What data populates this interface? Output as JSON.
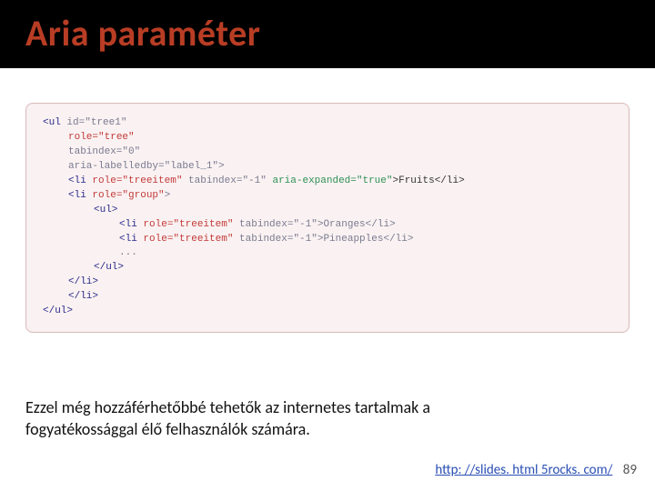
{
  "title": "Aria paraméter",
  "code": {
    "l1_open": "<ul",
    "l1_attr": " id=\"tree1\"",
    "l2_role_key": "role=",
    "l2_role_val": "\"tree\"",
    "l3": "tabindex=\"0\"",
    "l4": "aria-labelledby=\"label_1\">",
    "l5_open": "<li",
    "l5_role_key": " role=",
    "l5_role_val": "\"treeitem\"",
    "l5_tab": " tabindex=\"-1\" ",
    "l5_aria": "aria-expanded=\"true\"",
    "l5_close": ">Fruits</li>",
    "l6_open": "<li",
    "l6_role_key": " role=",
    "l6_role_val": "\"group\"",
    "l6_close": ">",
    "l7": "<ul>",
    "l8_open": "<li",
    "l8_role_key": " role=",
    "l8_role_val": "\"treeitem\"",
    "l8_rest": " tabindex=\"-1\">Oranges</li>",
    "l9_open": "<li",
    "l9_role_key": " role=",
    "l9_role_val": "\"treeitem\"",
    "l9_rest": " tabindex=\"-1\">Pineapples</li>",
    "l10": "...",
    "l11": "</ul>",
    "l12": "</li>",
    "l13": "</li>",
    "l14": "</ul>"
  },
  "caption_line1": "Ezzel még hozzáférhetőbbé tehetők az internetes tartalmak a",
  "caption_line2": "fogyatékossággal élő felhasználók számára.",
  "link_text": "http: //slides. html 5rocks. com/",
  "link_href": "http://slides.html5rocks.com/",
  "page_number": "89"
}
